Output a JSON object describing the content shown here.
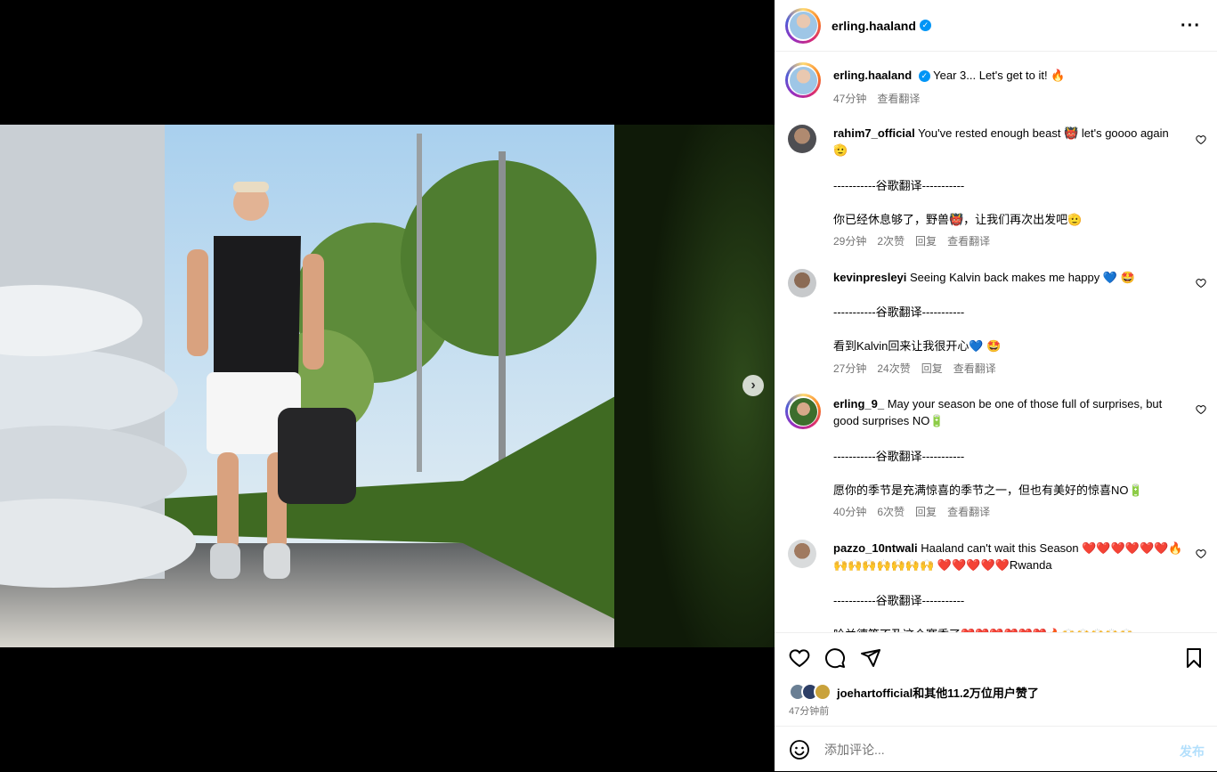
{
  "post": {
    "author": "erling.haaland",
    "caption_text": "Year 3... Let's get to it! 🔥",
    "caption_time": "47分钟",
    "see_translation": "查看翻译",
    "more_icon": "more-horizontal-icon",
    "image_count": 5,
    "active_image": 1
  },
  "comments": [
    {
      "user": "rahim7_official",
      "text": "You've rested enough beast 👹 let's goooo again 🫡",
      "divider": "-----------谷歌翻译-----------",
      "translation": "你已经休息够了，野兽👹，让我们再次出发吧🫡",
      "time": "29分钟",
      "likes": "2次赞",
      "reply": "回复",
      "see_translation": "查看翻译"
    },
    {
      "user": "kevinpresleyi",
      "text": "Seeing Kalvin back makes me happy 💙 🤩",
      "divider": "-----------谷歌翻译-----------",
      "translation": "看到Kalvin回来让我很开心💙 🤩",
      "time": "27分钟",
      "likes": "24次赞",
      "reply": "回复",
      "see_translation": "查看翻译"
    },
    {
      "user": "erling_9_",
      "text": "May your season be one of those full of surprises, but good surprises NO🔋",
      "divider": "-----------谷歌翻译-----------",
      "translation": "愿你的季节是充满惊喜的季节之一，但也有美好的惊喜NO🔋",
      "time": "40分钟",
      "likes": "6次赞",
      "reply": "回复",
      "see_translation": "查看翻译"
    },
    {
      "user": "pazzo_10ntwali",
      "text": "Haaland can't wait this Season ❤️❤️❤️❤️❤️❤️🔥🙌🙌🙌🙌🙌🙌🙌 ❤️❤️❤️❤️❤️Rwanda",
      "divider": "-----------谷歌翻译-----------",
      "translation": "哈兰德等不及这个赛季了❤️❤️❤️❤️❤️❤️🔥🙌🙌🙌🙌🙌",
      "time": "",
      "likes": "",
      "reply": "",
      "see_translation": ""
    }
  ],
  "footer": {
    "likes_text": "joehartofficial和其他11.2万位用户赞了",
    "time_ago": "47分钟前",
    "comment_placeholder": "添加评论...",
    "post_button": "发布"
  },
  "colors": {
    "verified": "#0095f6",
    "muted": "#737373",
    "post_disabled": "#b2dffc"
  }
}
